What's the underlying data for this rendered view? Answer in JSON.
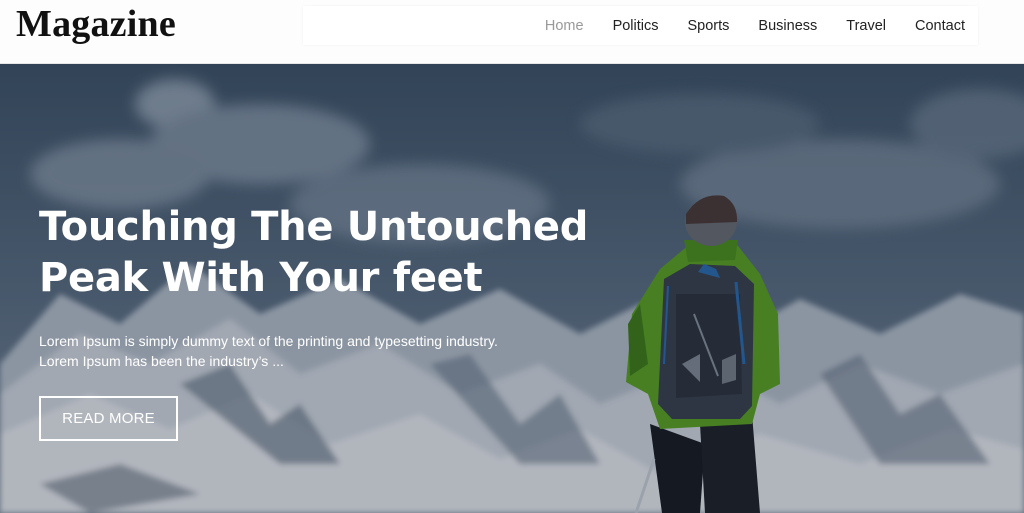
{
  "header": {
    "logo": "Magazine"
  },
  "nav": {
    "items": [
      {
        "label": "Home",
        "active": true
      },
      {
        "label": "Politics",
        "active": false
      },
      {
        "label": "Sports",
        "active": false
      },
      {
        "label": "Business",
        "active": false
      },
      {
        "label": "Travel",
        "active": false
      },
      {
        "label": "Contact",
        "active": false
      }
    ]
  },
  "hero": {
    "title_line1": "Touching The Untouched",
    "title_line2": "Peak With Your feet",
    "description_line1": "Lorem Ipsum is simply dummy text of the printing and typesetting industry.",
    "description_line2": "Lorem Ipsum has been the industry’s ...",
    "button_label": "READ MORE"
  },
  "colors": {
    "nav_active": "#999999",
    "nav_text": "#222222",
    "hero_text": "#ffffff",
    "jacket_green": "#5aa61e"
  }
}
